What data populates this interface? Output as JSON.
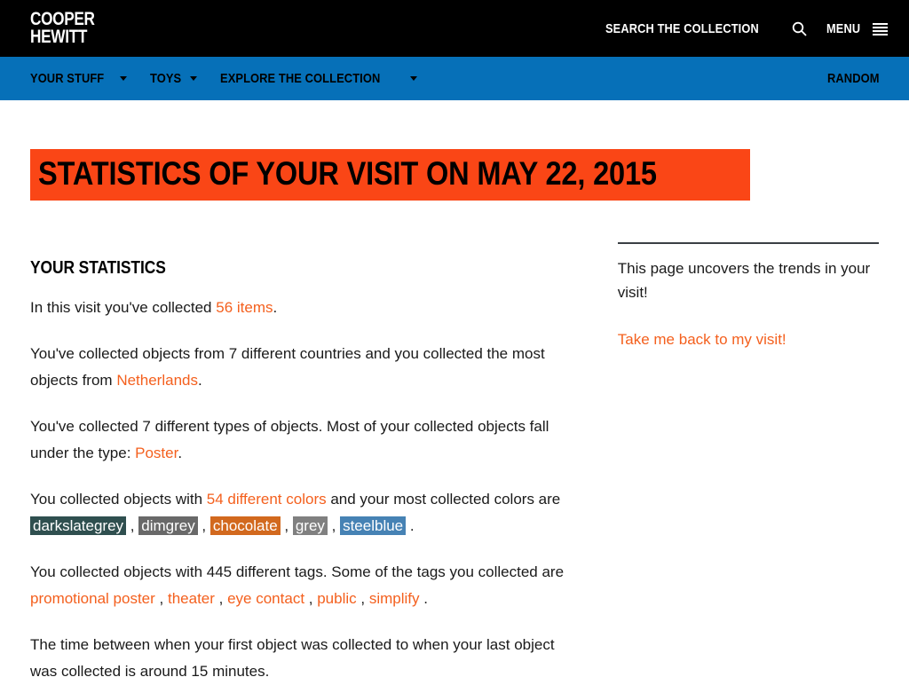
{
  "header": {
    "logo_line1": "COOPER",
    "logo_line2": "HEWITT",
    "search_label": "SEARCH THE COLLECTION",
    "menu_label": "MENU"
  },
  "nav": {
    "items": [
      {
        "label": "YOUR STUFF",
        "has_caret": true
      },
      {
        "label": "TOYS",
        "has_caret": true
      },
      {
        "label": "EXPLORE THE COLLECTION",
        "has_caret": true
      }
    ],
    "right_label": "RANDOM"
  },
  "page": {
    "title": "STATISTICS OF YOUR VISIT ON MAY 22, 2015",
    "title_bg": "#FA4616"
  },
  "main": {
    "heading": "YOUR STATISTICS",
    "p1": {
      "before": "In this visit you've collected ",
      "link": "56 items",
      "after": "."
    },
    "p2": {
      "before": "You've collected objects from 7 different countries and you collected the most objects from ",
      "link": "Netherlands",
      "after": "."
    },
    "p3": {
      "before": "You've collected 7 different types of objects. Most of your collected objects fall under the type: ",
      "link": "Poster",
      "after": "."
    },
    "p4": {
      "before": "You collected objects with ",
      "link_colors": "54 different colors",
      "middle": " and your most collected colors are ",
      "end": "."
    },
    "colors": [
      {
        "name": "darkslategrey",
        "hex": "#2F4F4F"
      },
      {
        "name": "dimgrey",
        "hex": "#696969"
      },
      {
        "name": "chocolate",
        "hex": "#D2691E"
      },
      {
        "name": "grey",
        "hex": "#808080"
      },
      {
        "name": "steelblue",
        "hex": "#4682B4"
      }
    ],
    "p5": {
      "before": "You collected objects with 445 different tags. Some of the tags you collected are "
    },
    "tags": [
      "promotional poster",
      "theater",
      "eye contact",
      "public",
      "simplify"
    ],
    "p5_end": ".",
    "p6": "The time between when your first object was collected to when your last object was collected is around 15 minutes."
  },
  "sidebar": {
    "text": "This page uncovers the trends in your visit!",
    "link": "Take me back to my visit!"
  }
}
